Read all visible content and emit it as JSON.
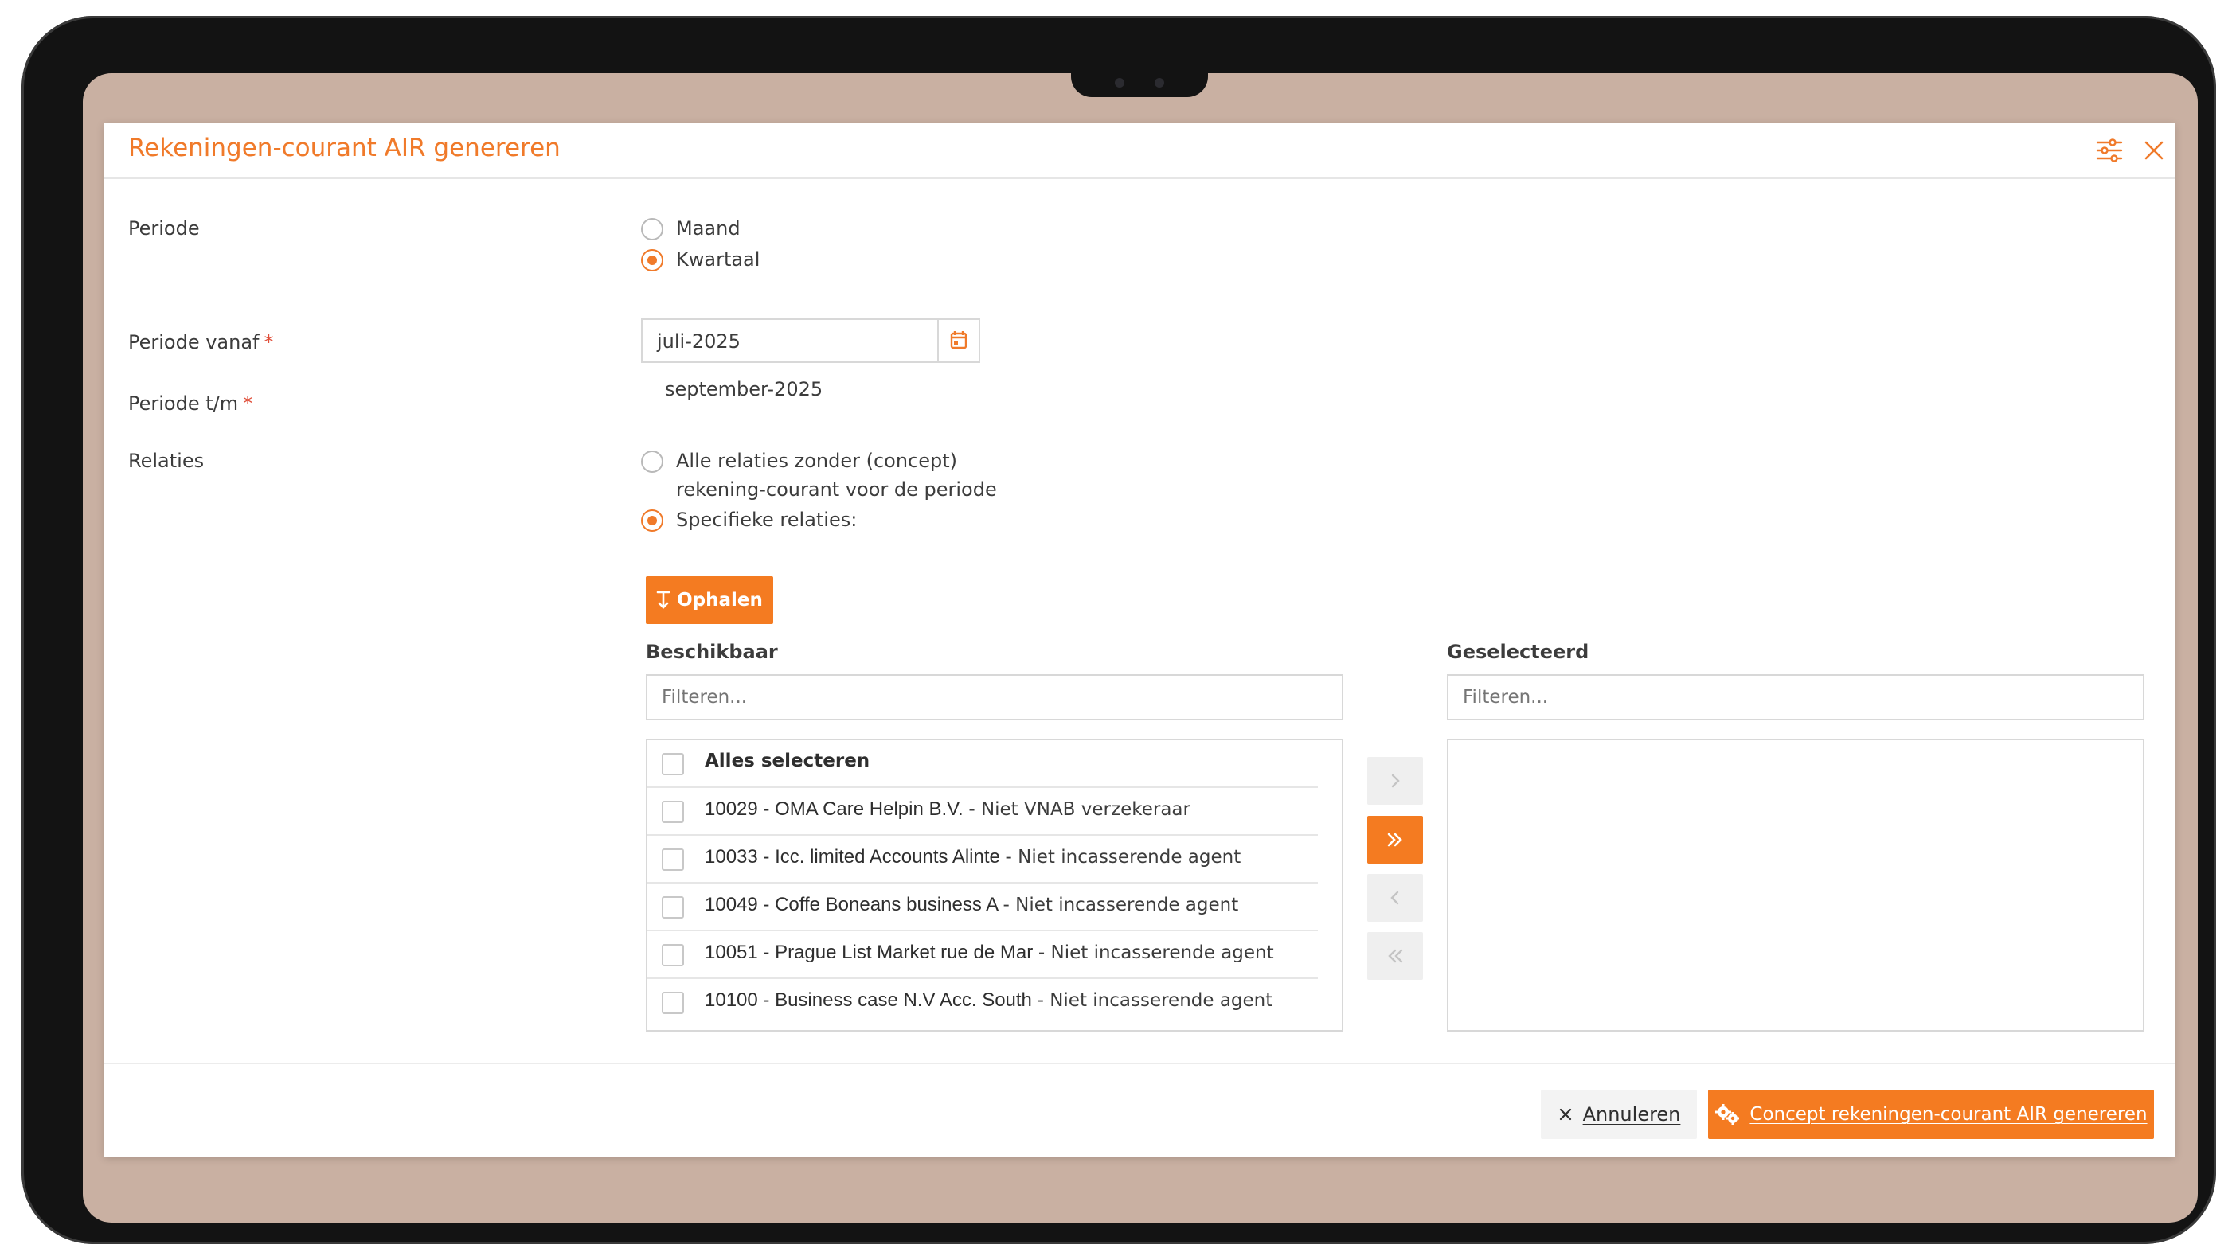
{
  "dialog": {
    "title": "Rekeningen-courant AIR genereren",
    "settings_icon": "sliders-icon",
    "close_icon": "close-icon"
  },
  "form": {
    "periode_label": "Periode",
    "periode_options": [
      {
        "label": "Maand",
        "selected": false
      },
      {
        "label": "Kwartaal",
        "selected": true
      }
    ],
    "periode_vanaf_label": "Periode vanaf",
    "periode_vanaf_value": "juli-2025",
    "periode_tm_label": "Periode t/m",
    "periode_tm_value": "september-2025",
    "required_marker": "*",
    "relaties_label": "Relaties",
    "relaties_options": [
      {
        "label_line1": "Alle relaties zonder (concept)",
        "label_line2": "rekening-courant voor de periode",
        "selected": false
      },
      {
        "label": "Specifieke relaties:",
        "selected": true
      }
    ],
    "ophalen_label": "Ophalen"
  },
  "available": {
    "title": "Beschikbaar",
    "filter_placeholder": "Filteren...",
    "select_all_label": "Alles selecteren",
    "items": [
      {
        "code": "10029",
        "name": "OMA Care Helpin B.V.",
        "status": "Niet VNAB verzekeraar"
      },
      {
        "code": "10033",
        "name": "Icc. limited Accounts Alinte",
        "status": "Niet incasserende agent"
      },
      {
        "code": "10049",
        "name": "Coffe Boneans business A",
        "status": "Niet incasserende agent"
      },
      {
        "code": "10051",
        "name": "Prague List Market rue de Mar",
        "status": "Niet incasserende agent"
      },
      {
        "code": "10100",
        "name": "Business case N.V Acc. South",
        "status": "Niet incasserende agent"
      }
    ]
  },
  "selected": {
    "title": "Geselecteerd",
    "filter_placeholder": "Filteren...",
    "items": []
  },
  "footer": {
    "cancel_label": "Annuleren",
    "generate_label": "Concept rekeningen-courant AIR genereren"
  },
  "colors": {
    "accent": "#f47b21",
    "title": "#f07a2a",
    "screen_bg": "#c9b0a2"
  }
}
